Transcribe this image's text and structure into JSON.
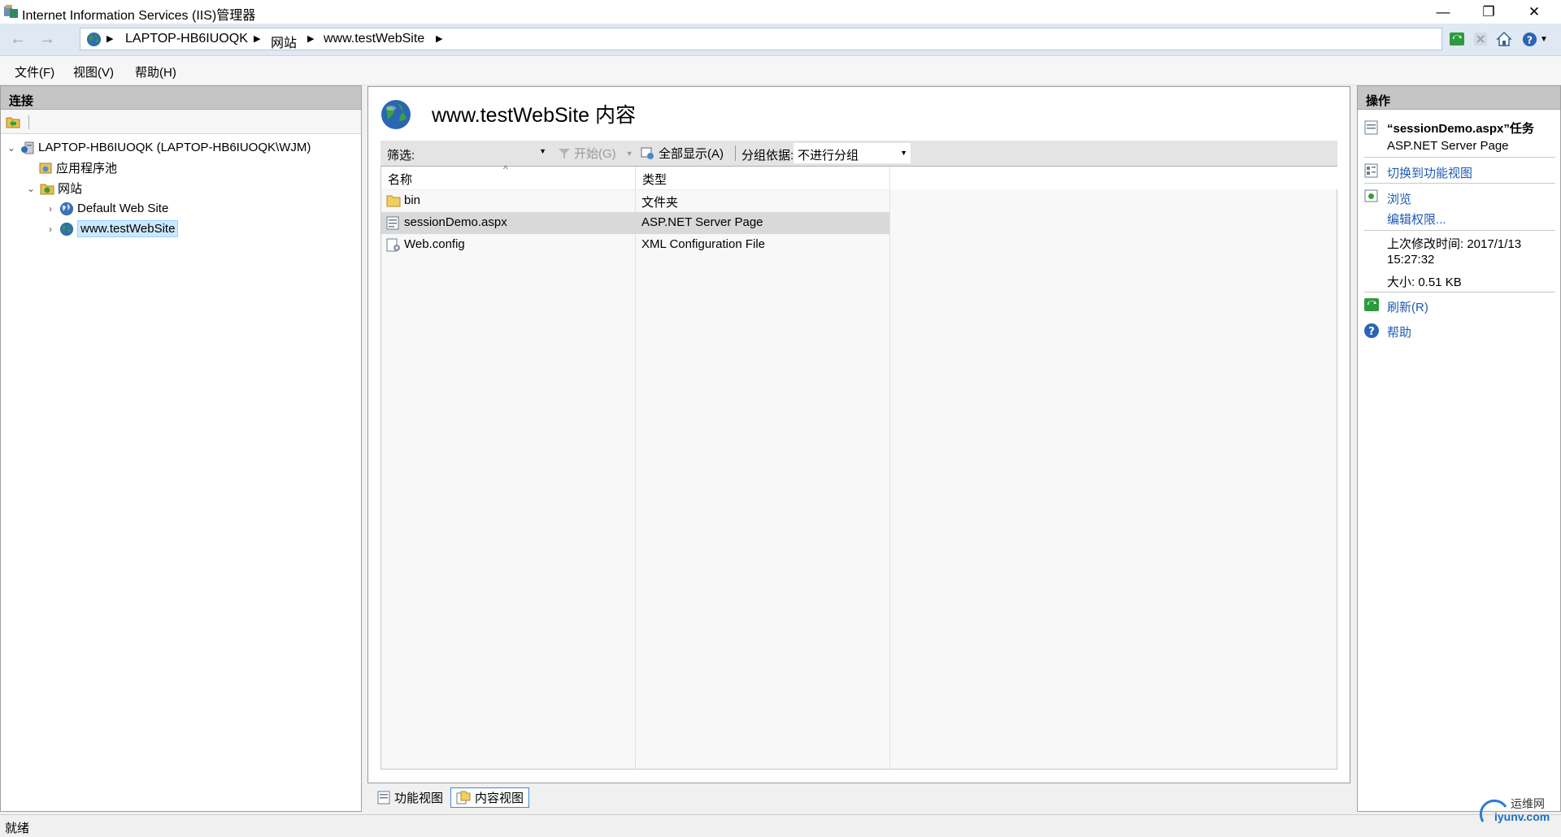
{
  "window": {
    "title": "Internet Information Services (IIS)管理器",
    "controls": {
      "minimize": "—",
      "restore": "❐",
      "close": "✕"
    }
  },
  "address": {
    "crumbs": [
      "LAPTOP-HB6IUOQK",
      "网站",
      "www.testWebSite"
    ]
  },
  "menu": {
    "file": "文件(F)",
    "view": "视图(V)",
    "help": "帮助(H)"
  },
  "connections": {
    "header": "连接",
    "tree": {
      "server": "LAPTOP-HB6IUOQK (LAPTOP-HB6IUOQK\\WJM)",
      "app_pools": "应用程序池",
      "sites": "网站",
      "site1": "Default Web Site",
      "site2": "www.testWebSite"
    }
  },
  "content": {
    "title": "www.testWebSite 内容",
    "filter": {
      "label": "筛选:",
      "value": "",
      "start": "开始(G)",
      "show_all": "全部显示(A)",
      "group_label": "分组依据:",
      "group_value": "不进行分组"
    },
    "columns": {
      "name": "名称",
      "type": "类型"
    },
    "rows": [
      {
        "name": "bin",
        "type": "文件夹"
      },
      {
        "name": "sessionDemo.aspx",
        "type": "ASP.NET Server Page"
      },
      {
        "name": "Web.config",
        "type": "XML Configuration File"
      }
    ],
    "selected_row": 1
  },
  "actions": {
    "header": "操作",
    "task_title": "“sessionDemo.aspx”任务",
    "task_subtitle": "ASP.NET Server Page",
    "switch_view": "切换到功能视图",
    "browse": "浏览",
    "edit_perms": "编辑权限...",
    "modified_label": "上次修改时间: 2017/1/13",
    "modified_time": "15:27:32",
    "size": "大小: 0.51 KB",
    "refresh": "刷新(R)",
    "help": "帮助"
  },
  "view_tabs": {
    "features": "功能视图",
    "content": "内容视图"
  },
  "status": {
    "text": "就绪"
  },
  "watermark": {
    "cn": "运维网",
    "en": "iyunv.com"
  },
  "colors": {
    "accent": "#1f5bb3",
    "selection": "#cce8ff",
    "row_selected": "#d9d9d9"
  }
}
